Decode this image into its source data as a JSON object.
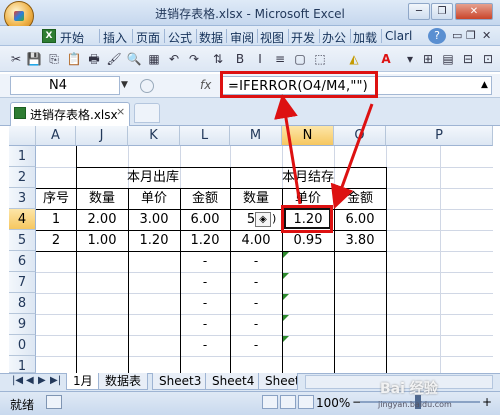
{
  "window": {
    "title": "进销存表格.xlsx - Microsoft Excel",
    "minimize": "─",
    "restore": "❐",
    "close": "✕"
  },
  "ribbon": {
    "app_icon": "X",
    "tabs": [
      "开始",
      "插入",
      "页面",
      "公式",
      "数据",
      "审阅",
      "视图",
      "开发",
      "办公",
      "加载",
      "Clarl"
    ]
  },
  "toolbar": {
    "icons": [
      "cut-icon",
      "copy-icon",
      "paste-icon",
      "format-painter-icon",
      "undo-icon",
      "redo-icon",
      "font-color-icon",
      "help-icon",
      "minimize-ribbon-icon",
      "close-workbook-icon"
    ]
  },
  "formula_bar": {
    "name_box": "N4",
    "fx": "fx",
    "formula": "=IFERROR(O4/M4,\"\")"
  },
  "workbook_tab": {
    "label": "进销存表格.xlsx",
    "close": "×"
  },
  "grid": {
    "columns": [
      "A",
      "J",
      "K",
      "L",
      "M",
      "N",
      "O",
      "P"
    ],
    "active_column": "N",
    "rows": [
      "1",
      "2",
      "3",
      "4",
      "5",
      "6",
      "7",
      "8",
      "9",
      "0",
      "1"
    ],
    "active_row": "4",
    "header_groups": [
      "本月出库",
      "本月结存"
    ],
    "headers": [
      "序号",
      "数量",
      "单价",
      "金额",
      "数量",
      "单价",
      "金额"
    ],
    "data_rows": [
      [
        "1",
        "2.00",
        "3.00",
        "6.00",
        "5",
        "1.20",
        "6.00"
      ],
      [
        "2",
        "1.00",
        "1.20",
        "1.20",
        "4.00",
        "0.95",
        "3.80"
      ]
    ],
    "dash": "-",
    "error_icon": "◈"
  },
  "sheets": {
    "tabs": [
      "1月",
      "数据表",
      "Sheet3",
      "Sheet4",
      "Sheet"
    ],
    "active": "1月"
  },
  "status": {
    "text": "就绪",
    "zoom": "100%",
    "zoom_minus": "−",
    "zoom_plus": "+"
  },
  "watermark": {
    "brand": "Bai 经验",
    "url": "jingyan.baidu.com"
  },
  "colors": {
    "annotation_red": "#d11",
    "header_active": "#f6c760",
    "ribbon_bg": "#d3e1f2"
  }
}
